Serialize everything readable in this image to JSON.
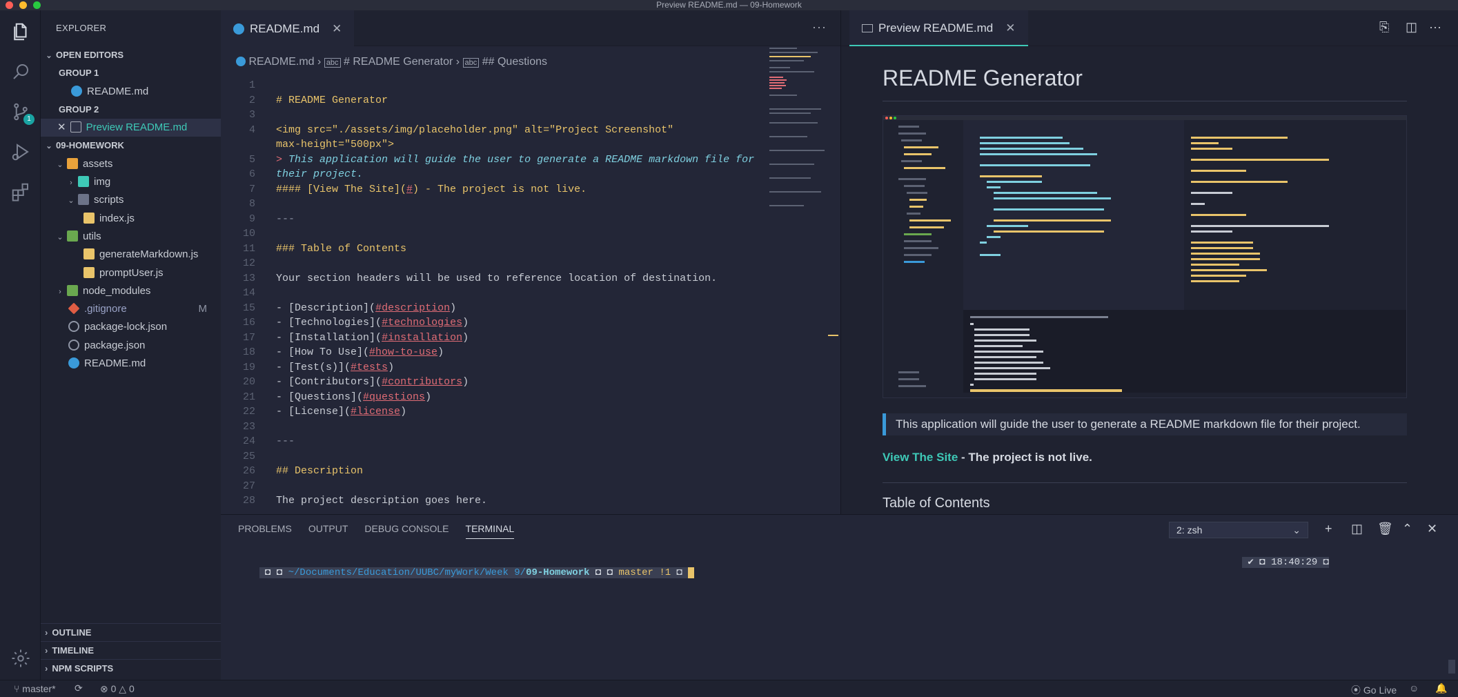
{
  "window": {
    "title": "Preview README.md — 09-Homework"
  },
  "activity_bar": {
    "scm_badge": "1"
  },
  "explorer": {
    "header": "EXPLORER",
    "open_editors": "OPEN EDITORS",
    "group1": "GROUP 1",
    "group1_file": "README.md",
    "group2": "GROUP 2",
    "group2_file": "Preview README.md",
    "project": "09-HOMEWORK",
    "tree": {
      "assets": "assets",
      "img": "img",
      "scripts": "scripts",
      "indexjs": "index.js",
      "utils": "utils",
      "genmd": "generateMarkdown.js",
      "prompt": "promptUser.js",
      "node_modules": "node_modules",
      "gitignore": ".gitignore",
      "gitignore_badge": "M",
      "pkglock": "package-lock.json",
      "pkg": "package.json",
      "readme": "README.md"
    },
    "outline": "OUTLINE",
    "timeline": "TIMELINE",
    "npm": "NPM SCRIPTS"
  },
  "editor": {
    "tab": "README.md",
    "breadcrumb": {
      "file": "README.md",
      "h1": "# README Generator",
      "h2": "## Questions"
    },
    "lines": {
      "l2": "# README Generator",
      "l4a": "<img src=\"./assets/img/placeholder.png\" alt=\"Project Screenshot\"",
      "l4b": "max-height=\"500px\">",
      "l6a": "> ",
      "l6b": "This application will guide the user to generate a README markdown file for",
      "l6c": "their project.",
      "l8a": "#### [View The Site](",
      "l8b": "#",
      "l8c": ") - The project is not live.",
      "l10": "---",
      "l12": "### Table of Contents",
      "l14": "Your section headers will be used to reference location of destination.",
      "toc": [
        {
          "label": "Description",
          "link": "#description"
        },
        {
          "label": "Technologies",
          "link": "#technologies"
        },
        {
          "label": "Installation",
          "link": "#installation"
        },
        {
          "label": "How To Use",
          "link": "#how-to-use"
        },
        {
          "label": "Test(s)",
          "link": "#tests"
        },
        {
          "label": "Contributors",
          "link": "#contributors"
        },
        {
          "label": "Questions",
          "link": "#questions"
        },
        {
          "label": "License",
          "link": "#license"
        }
      ],
      "l25": "---",
      "l27": "## Description",
      "l29": "The project description goes here."
    }
  },
  "preview": {
    "tab": "Preview README.md",
    "h1": "README Generator",
    "quote": "This application will guide the user to generate a README markdown file for their project.",
    "h4_link": "View The Site",
    "h4_rest": " - The project is not live.",
    "h3": "Table of Contents"
  },
  "panel": {
    "tabs": [
      "PROBLEMS",
      "OUTPUT",
      "DEBUG CONSOLE",
      "TERMINAL"
    ],
    "terminal_select": "2: zsh",
    "prompt_path": "~/Documents/Education/UUBC/myWork/Week 9/",
    "prompt_dir": "09-Homework",
    "prompt_branch": "master !1",
    "prompt_time": "18:40:29"
  },
  "statusbar": {
    "branch": "master*",
    "errors": "0",
    "warnings": "0",
    "golive": "Go Live"
  },
  "colors": {
    "accent": "#3ec9b7",
    "bg": "#232637"
  }
}
